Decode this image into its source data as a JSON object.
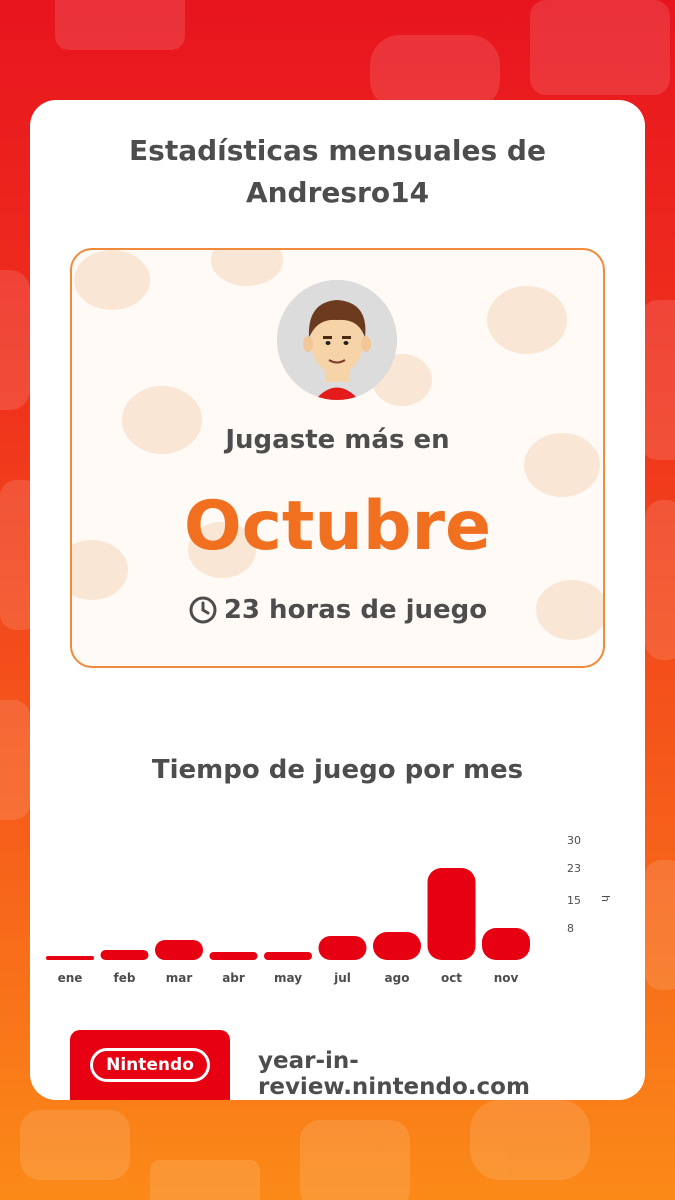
{
  "header": {
    "title_line1": "Estadísticas mensuales de",
    "title_line2": "Andresro14"
  },
  "highlight": {
    "label": "Jugaste más en",
    "month": "Octubre",
    "hours_text": "23 horas de juego",
    "clock_icon": "clock-icon",
    "accent_color": "#f07020"
  },
  "chart_section": {
    "title": "Tiempo de juego por mes"
  },
  "chart_data": {
    "type": "bar",
    "categories": [
      "ene",
      "feb",
      "mar",
      "abr",
      "may",
      "jul",
      "ago",
      "oct",
      "nov"
    ],
    "values": [
      1,
      2.5,
      5,
      2,
      2,
      6,
      7,
      23,
      8
    ],
    "y_ticks": [
      "30",
      "23",
      "15",
      "8"
    ],
    "y_unit": "h",
    "ylim": [
      0,
      30
    ],
    "bar_color": "#e60012"
  },
  "footer": {
    "brand": "Nintendo",
    "url": "year-in-review.nintendo.com",
    "brand_color": "#e60012"
  }
}
